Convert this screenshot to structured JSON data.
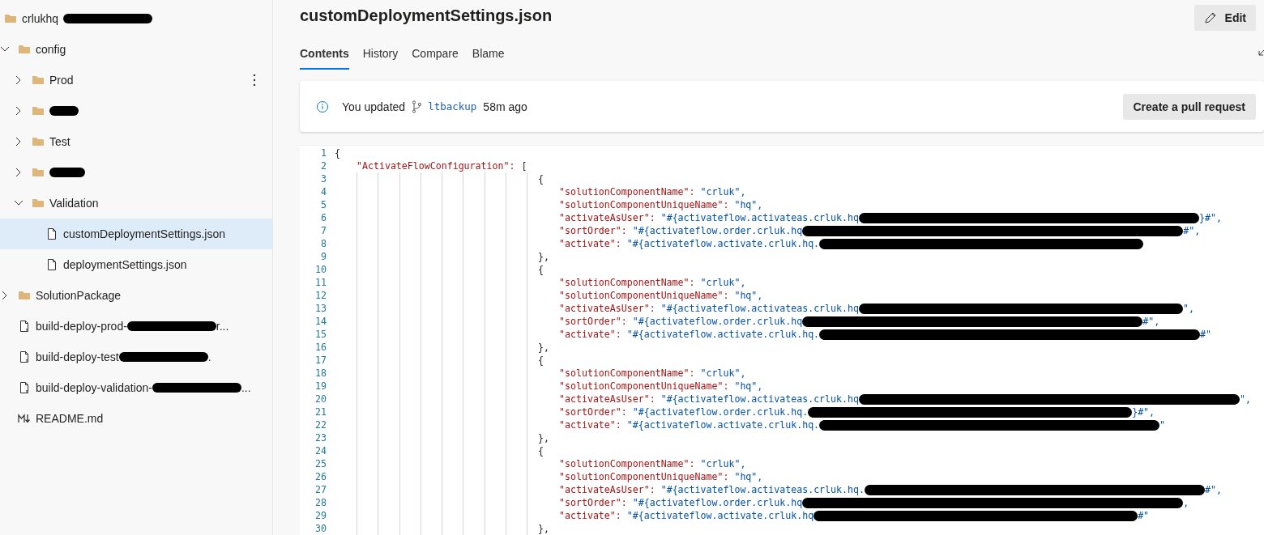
{
  "sidebar": {
    "root": {
      "label": "crlukhq",
      "redacted": true
    },
    "items": [
      {
        "kind": "folder",
        "label": "config",
        "expanded": true,
        "selected": false,
        "children": [
          {
            "kind": "folder",
            "label": "Prod",
            "expanded": false,
            "selected": false,
            "more": true
          },
          {
            "kind": "folder",
            "redacted": true,
            "expanded": false,
            "selected": false
          },
          {
            "kind": "folder",
            "label": "Test",
            "expanded": false,
            "selected": false
          },
          {
            "kind": "folder",
            "redacted": true,
            "expanded": false,
            "selected": false
          },
          {
            "kind": "folder",
            "label": "Validation",
            "expanded": true,
            "selected": false,
            "children": [
              {
                "kind": "file",
                "label": "customDeploymentSettings.json",
                "selected": true
              },
              {
                "kind": "file",
                "label": "deploymentSettings.json",
                "selected": false
              }
            ]
          }
        ]
      },
      {
        "kind": "folder",
        "label": "SolutionPackage",
        "expanded": false,
        "selected": false
      },
      {
        "kind": "yaml",
        "label": "build-deploy-prod-",
        "redacted": true,
        "tail": "r...",
        "selected": false
      },
      {
        "kind": "yaml",
        "label": "build-deploy-test",
        "redacted": true,
        "tail": ".",
        "selected": false
      },
      {
        "kind": "yaml",
        "label": "build-deploy-validation-",
        "redacted": true,
        "tail": "...",
        "selected": false
      },
      {
        "kind": "markdown",
        "label": "README.md",
        "selected": false
      }
    ]
  },
  "file": {
    "title": "customDeploymentSettings.json",
    "edit_button": "Edit",
    "tabs": [
      {
        "label": "Contents",
        "selected": true
      },
      {
        "label": "History",
        "selected": false
      },
      {
        "label": "Compare",
        "selected": false
      },
      {
        "label": "Blame",
        "selected": false
      }
    ],
    "banner": {
      "prefix": "You updated",
      "branch": "ltbackup",
      "time": "58m ago",
      "button": "Create a pull request"
    },
    "code": [
      {
        "n": "1",
        "kind": "root-open",
        "text": "{"
      },
      {
        "n": "2",
        "kind": "array-key",
        "key": "\"ActivateFlowConfiguration\":",
        "text": "["
      },
      {
        "n": "3",
        "kind": "item-open",
        "text": "{"
      },
      {
        "n": "4",
        "kind": "field",
        "key": "\"solutionComponentName\":",
        "value": "\"crluk\"",
        "tail": ","
      },
      {
        "n": "5",
        "kind": "field",
        "key": "\"solutionComponentUniqueName\":",
        "value": "\"hq\"",
        "tail": ","
      },
      {
        "n": "6",
        "kind": "field",
        "key": "\"activateAsUser\":",
        "value": "\"#{activateflow.activateas.crluk.hq",
        "redacted": true,
        "tail": "}#\","
      },
      {
        "n": "7",
        "kind": "field",
        "key": "\"sortOrder\":",
        "value": "\"#{activateflow.order.crluk.hq",
        "redacted": true,
        "tail": "#\","
      },
      {
        "n": "8",
        "kind": "field",
        "key": "\"activate\":",
        "value": "\"#{activateflow.activate.crluk.hq.",
        "redacted": true
      },
      {
        "n": "9",
        "kind": "item-close",
        "text": "},"
      },
      {
        "n": "10",
        "kind": "item-open",
        "text": "{"
      },
      {
        "n": "11",
        "kind": "field",
        "key": "\"solutionComponentName\":",
        "value": "\"crluk\"",
        "tail": ","
      },
      {
        "n": "12",
        "kind": "field",
        "key": "\"solutionComponentUniqueName\":",
        "value": "\"hq\"",
        "tail": ","
      },
      {
        "n": "13",
        "kind": "field",
        "key": "\"activateAsUser\":",
        "value": "\"#{activateflow.activateas.crluk.hq",
        "redacted": true,
        "tail": "\","
      },
      {
        "n": "14",
        "kind": "field",
        "key": "\"sortOrder\":",
        "value": "\"#{activateflow.order.crluk.hq",
        "redacted": true,
        "tail": "#\","
      },
      {
        "n": "15",
        "kind": "field",
        "key": "\"activate\":",
        "value": "\"#{activateflow.activate.crluk.hq.",
        "redacted": true,
        "tail": "#\""
      },
      {
        "n": "16",
        "kind": "item-close",
        "text": "},"
      },
      {
        "n": "17",
        "kind": "item-open",
        "text": "{"
      },
      {
        "n": "18",
        "kind": "field",
        "key": "\"solutionComponentName\":",
        "value": "\"crluk\"",
        "tail": ","
      },
      {
        "n": "19",
        "kind": "field",
        "key": "\"solutionComponentUniqueName\":",
        "value": "\"hq\"",
        "tail": ","
      },
      {
        "n": "20",
        "kind": "field",
        "key": "\"activateAsUser\":",
        "value": "\"#{activateflow.activateas.crluk.hq",
        "redacted": true,
        "tail": "\","
      },
      {
        "n": "21",
        "kind": "field",
        "key": "\"sortOrder\":",
        "value": "\"#{activateflow.order.crluk.hq.",
        "redacted": true,
        "tail": "}#\","
      },
      {
        "n": "22",
        "kind": "field",
        "key": "\"activate\":",
        "value": "\"#{activateflow.activate.crluk.hq.",
        "redacted": true,
        "tail": "\""
      },
      {
        "n": "23",
        "kind": "item-close",
        "text": "},"
      },
      {
        "n": "24",
        "kind": "item-open",
        "text": "{"
      },
      {
        "n": "25",
        "kind": "field",
        "key": "\"solutionComponentName\":",
        "value": "\"crluk\"",
        "tail": ","
      },
      {
        "n": "26",
        "kind": "field",
        "key": "\"solutionComponentUniqueName\":",
        "value": "\"hq\"",
        "tail": ","
      },
      {
        "n": "27",
        "kind": "field",
        "key": "\"activateAsUser\":",
        "value": "\"#{activateflow.activateas.crluk.hq.",
        "redacted": true,
        "tail": "#\","
      },
      {
        "n": "28",
        "kind": "field",
        "key": "\"sortOrder\":",
        "value": "\"#{activateflow.order.crluk.hq",
        "redacted": true,
        "tail": ","
      },
      {
        "n": "29",
        "kind": "field",
        "key": "\"activate\":",
        "value": "\"#{activateflow.activate.crluk.hq",
        "redacted": true,
        "tail": "#\""
      },
      {
        "n": "30",
        "kind": "item-close",
        "text": "},"
      }
    ]
  }
}
